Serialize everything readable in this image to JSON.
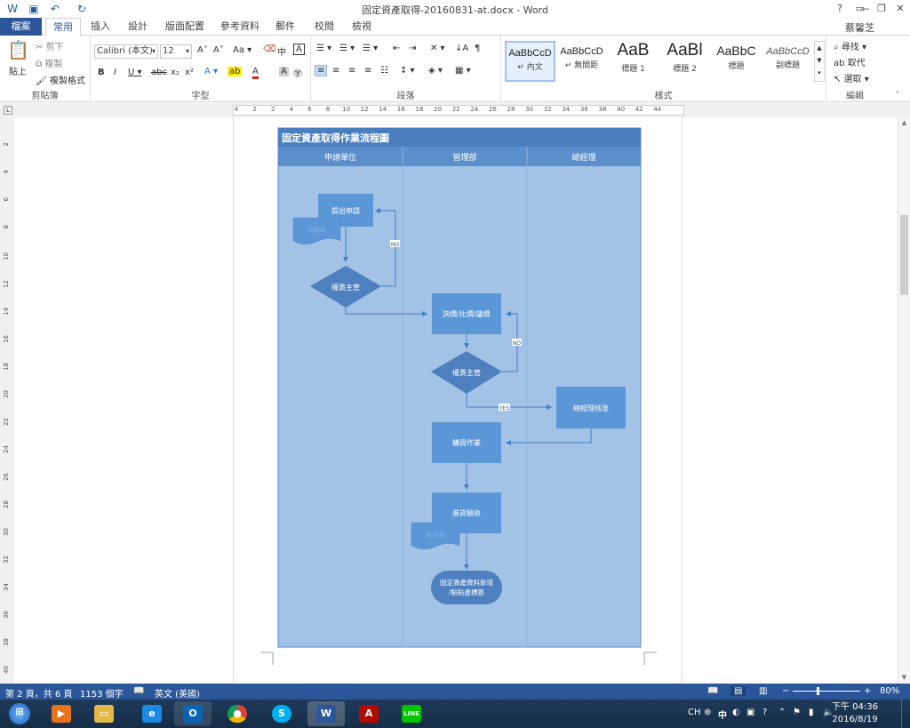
{
  "window": {
    "title": "固定資產取得-20160831-at.docx - Word",
    "user": "蔡馨芝",
    "help": "?",
    "min": "—",
    "max": "❐",
    "close": "✕"
  },
  "tabs": [
    "檔案",
    "常用",
    "插入",
    "設計",
    "版面配置",
    "參考資料",
    "郵件",
    "校閱",
    "檢視"
  ],
  "ribbon": {
    "clipboard": {
      "label": "剪貼簿",
      "paste": "貼上",
      "cut": "剪下",
      "copy": "複製",
      "format_painter": "複製格式"
    },
    "font": {
      "label": "字型",
      "name": "Calibri (本文)",
      "size": "12",
      "case": "Aa",
      "phonetic": "中",
      "box": "A"
    },
    "paragraph": {
      "label": "段落"
    },
    "styles": {
      "label": "樣式",
      "items": [
        {
          "sample": "AaBbCcD",
          "name": "↵ 內文"
        },
        {
          "sample": "AaBbCcD",
          "name": "↵ 無間距"
        },
        {
          "sample": "AaB",
          "name": "標題 1"
        },
        {
          "sample": "AaBl",
          "name": "標題 2"
        },
        {
          "sample": "AaBbC",
          "name": "標題"
        },
        {
          "sample": "AaBbCcD",
          "name": "副標題"
        }
      ]
    },
    "editing": {
      "label": "編輯",
      "find": "尋找",
      "replace": "取代",
      "select": "選取"
    }
  },
  "ruler": {
    "h_ticks": [
      "4",
      "2",
      "2",
      "4",
      "6",
      "8",
      "10",
      "12",
      "14",
      "16",
      "18",
      "20",
      "22",
      "24",
      "26",
      "28",
      "30",
      "32",
      "34",
      "36",
      "38",
      "40",
      "42",
      "44"
    ],
    "v_ticks": [
      "2",
      "4",
      "6",
      "8",
      "10",
      "12",
      "14",
      "16",
      "18",
      "20",
      "22",
      "24",
      "26",
      "28",
      "30",
      "32",
      "34",
      "36",
      "38",
      "40"
    ]
  },
  "flowchart": {
    "title": "固定資產取得作業流程圖",
    "lanes": [
      "申請單位",
      "管理部",
      "總經理"
    ],
    "nodes": {
      "apply": "提出申請",
      "apply_doc": "請購單",
      "review1": "權責主管",
      "quote": "詢價/比價/議價",
      "review2": "權責主管",
      "gm_approve": "總經理核准",
      "purchase": "購買作業",
      "inspect": "進貨驗收",
      "inspect_doc": "驗收單",
      "register_1": "固定資產資料新增",
      "register_2": "/黏貼產標簽"
    },
    "edge_labels": {
      "no1": "NO",
      "no2": "NO",
      "yes": "YES"
    }
  },
  "status": {
    "page": "第 2 頁，共 6 頁",
    "words": "1153 個字",
    "lang": "英文 (美國)",
    "zoom": "80%"
  },
  "taskbar": {
    "time": "下午 04:36",
    "date": "2016/8/19",
    "ime": "CH",
    "ime2": "中"
  }
}
